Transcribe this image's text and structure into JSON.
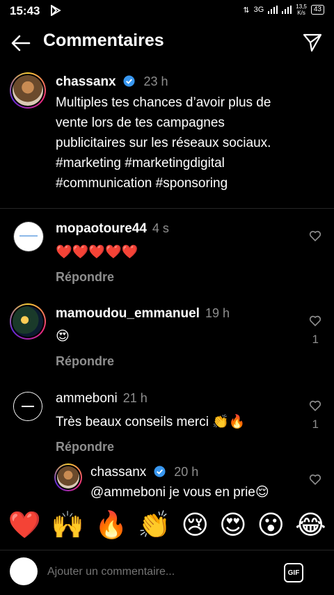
{
  "status": {
    "time": "15:43",
    "network": "3G",
    "speed_value": "13,5",
    "speed_unit": "K/s",
    "battery": "43"
  },
  "header": {
    "title": "Commentaires"
  },
  "caption": {
    "username": "chassanx",
    "time": "23 h",
    "lines": [
      "Multiples tes chances d’avoir plus de",
      "vente lors de tes campagnes",
      "publicitaires sur les réseaux sociaux.",
      "#marketing #marketingdigital",
      "#communication #sponsoring"
    ]
  },
  "comments": [
    {
      "username": "mopaotoure44",
      "time": "4 s",
      "text": "❤️❤️❤️❤️❤️",
      "reply": "Répondre",
      "likes": ""
    },
    {
      "username": "mamoudou_emmanuel",
      "time": "19 h",
      "text": "😍",
      "reply": "Répondre",
      "likes": "1"
    },
    {
      "username": "ammeboni",
      "time": "21 h",
      "text": "Très beaux conseils merci 👏🔥",
      "reply": "Répondre",
      "likes": "1"
    },
    {
      "username": "chassanx",
      "time": "20 h",
      "text": "@ammeboni je vous en prie😌"
    }
  ],
  "emoji_bar": [
    "❤️",
    "🙌",
    "🔥",
    "👏",
    "😢",
    "😍",
    "😮",
    "😂"
  ],
  "input": {
    "placeholder": "Ajouter un commentaire...",
    "gif_label": "GIF"
  },
  "colors": {
    "background": "#000000",
    "secondary_text": "#8e8e8e",
    "verified": "#3897f0"
  }
}
